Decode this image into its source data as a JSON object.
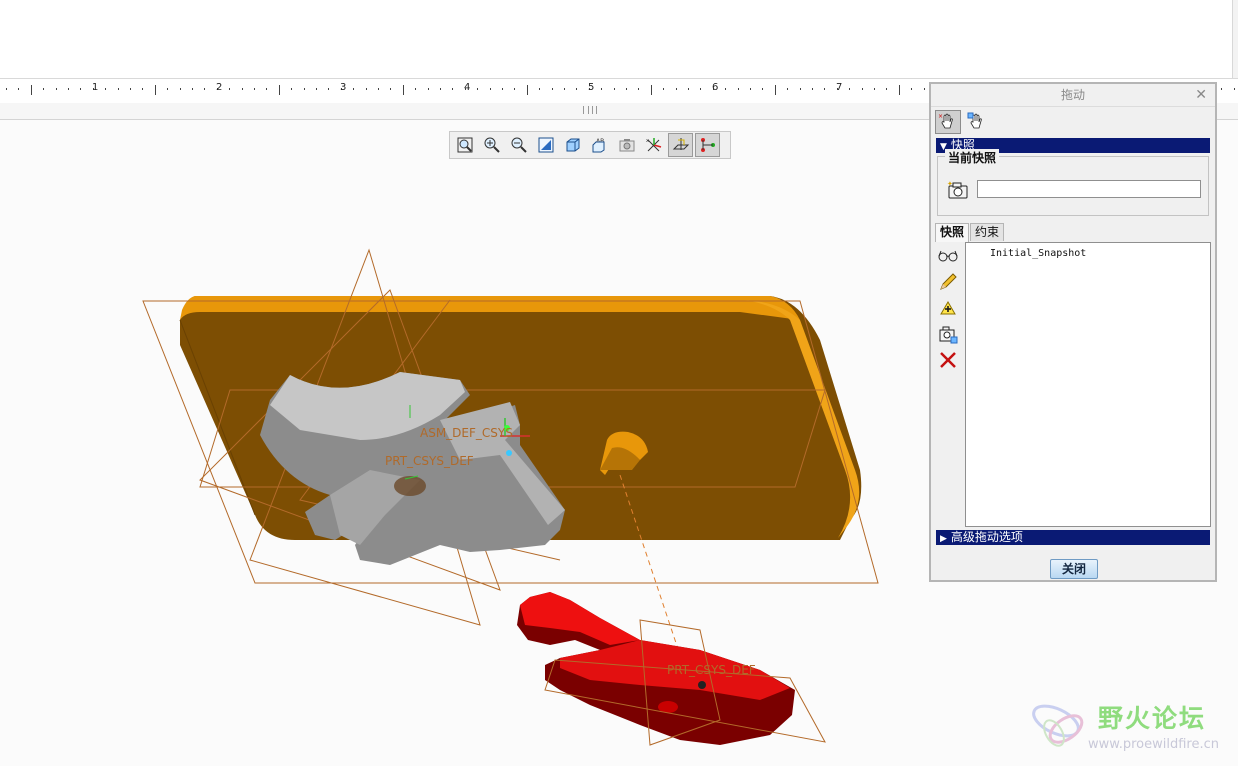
{
  "ruler": {
    "numbers": [
      "1",
      "2",
      "3",
      "4",
      "5",
      "6",
      "7"
    ]
  },
  "view_toolbar": {
    "icons": [
      "refit-icon",
      "zoom-in-icon",
      "zoom-out-icon",
      "repaint-icon",
      "saved-views-icon",
      "annotation-display-icon",
      "spin-center-icon",
      "csys-display-icon",
      "datum-planes-icon",
      "connections-icon"
    ],
    "active": [
      8,
      9
    ]
  },
  "viewport": {
    "labels": [
      "ASM_DEF_CSYS",
      "PRT_CSYS_DEF",
      "PRT_CSYS_DEF"
    ],
    "colors": {
      "base": "#e8970a",
      "base_dark": "#7a4b02",
      "gear": "#b8b8b8",
      "lever": "#e60000",
      "datum": "#b36a2a"
    }
  },
  "dialog": {
    "title": "拖动",
    "close_icon": "close-icon",
    "snapshot_section": "快照",
    "current_snapshot_label": "当前快照",
    "current_snapshot_value": "",
    "tabs": [
      "快照",
      "约束"
    ],
    "snapshots": [
      "Initial_Snapshot"
    ],
    "advanced_section": "高级拖动选项",
    "close_button": "关闭"
  },
  "watermark": {
    "title": "野火论坛",
    "url": "www.proewildfire.cn"
  }
}
